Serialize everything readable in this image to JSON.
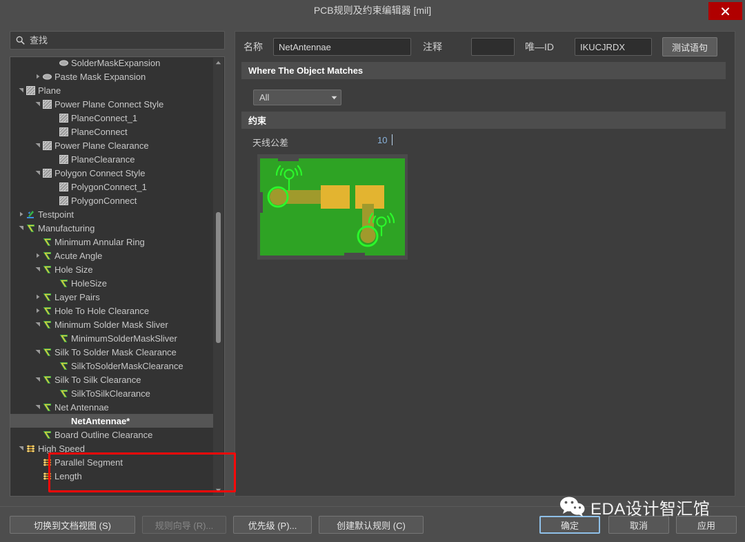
{
  "window": {
    "title": "PCB规则及约束编辑器 [mil]",
    "close_label": "✕",
    "close_color": "#b00000"
  },
  "search": {
    "placeholder": "查找",
    "value": "",
    "icon": "search-icon"
  },
  "tree": {
    "scroll_icons": {
      "up": "▲",
      "down": "▼"
    },
    "items": [
      {
        "label": "SolderMaskExpansion",
        "depth": 3,
        "twisty": "",
        "icon": "mask-icon",
        "selected": false
      },
      {
        "label": "Paste Mask Expansion",
        "depth": 2,
        "twisty": "▸",
        "icon": "mask-icon",
        "selected": false
      },
      {
        "label": "Plane",
        "depth": 1,
        "twisty": "▾",
        "icon": "plane-icon",
        "selected": false
      },
      {
        "label": "Power Plane Connect Style",
        "depth": 2,
        "twisty": "▾",
        "icon": "plane-icon",
        "selected": false
      },
      {
        "label": "PlaneConnect_1",
        "depth": 3,
        "twisty": "",
        "icon": "plane-icon",
        "selected": false
      },
      {
        "label": "PlaneConnect",
        "depth": 3,
        "twisty": "",
        "icon": "plane-icon",
        "selected": false
      },
      {
        "label": "Power Plane Clearance",
        "depth": 2,
        "twisty": "▾",
        "icon": "plane-icon",
        "selected": false
      },
      {
        "label": "PlaneClearance",
        "depth": 3,
        "twisty": "",
        "icon": "plane-icon",
        "selected": false
      },
      {
        "label": "Polygon Connect Style",
        "depth": 2,
        "twisty": "▾",
        "icon": "plane-icon",
        "selected": false
      },
      {
        "label": "PolygonConnect_1",
        "depth": 3,
        "twisty": "",
        "icon": "plane-icon",
        "selected": false
      },
      {
        "label": "PolygonConnect",
        "depth": 3,
        "twisty": "",
        "icon": "plane-icon",
        "selected": false
      },
      {
        "label": "Testpoint",
        "depth": 1,
        "twisty": "▸",
        "icon": "testpoint-icon",
        "selected": false
      },
      {
        "label": "Manufacturing",
        "depth": 1,
        "twisty": "▾",
        "icon": "mfg-icon",
        "selected": false
      },
      {
        "label": "Minimum Annular Ring",
        "depth": 2,
        "twisty": "",
        "icon": "mfg-icon",
        "selected": false
      },
      {
        "label": "Acute Angle",
        "depth": 2,
        "twisty": "▸",
        "icon": "mfg-icon",
        "selected": false
      },
      {
        "label": "Hole Size",
        "depth": 2,
        "twisty": "▾",
        "icon": "mfg-icon",
        "selected": false
      },
      {
        "label": "HoleSize",
        "depth": 3,
        "twisty": "",
        "icon": "mfg-icon",
        "selected": false
      },
      {
        "label": "Layer Pairs",
        "depth": 2,
        "twisty": "▸",
        "icon": "mfg-icon",
        "selected": false
      },
      {
        "label": "Hole To Hole Clearance",
        "depth": 2,
        "twisty": "▸",
        "icon": "mfg-icon",
        "selected": false
      },
      {
        "label": "Minimum Solder Mask Sliver",
        "depth": 2,
        "twisty": "▾",
        "icon": "mfg-icon",
        "selected": false
      },
      {
        "label": "MinimumSolderMaskSliver",
        "depth": 3,
        "twisty": "",
        "icon": "mfg-icon",
        "selected": false
      },
      {
        "label": "Silk To Solder Mask Clearance",
        "depth": 2,
        "twisty": "▾",
        "icon": "mfg-icon",
        "selected": false
      },
      {
        "label": "SilkToSolderMaskClearance",
        "depth": 3,
        "twisty": "",
        "icon": "mfg-icon",
        "selected": false
      },
      {
        "label": "Silk To Silk Clearance",
        "depth": 2,
        "twisty": "▾",
        "icon": "mfg-icon",
        "selected": false
      },
      {
        "label": "SilkToSilkClearance",
        "depth": 3,
        "twisty": "",
        "icon": "mfg-icon",
        "selected": false
      },
      {
        "label": "Net Antennae",
        "depth": 2,
        "twisty": "▾",
        "icon": "mfg-icon",
        "selected": false
      },
      {
        "label": "NetAntennae*",
        "depth": 3,
        "twisty": "",
        "icon": "mfg-icon",
        "selected": true
      },
      {
        "label": "Board Outline Clearance",
        "depth": 2,
        "twisty": "",
        "icon": "mfg-icon",
        "selected": false
      },
      {
        "label": "High Speed",
        "depth": 1,
        "twisty": "▾",
        "icon": "highspeed-icon",
        "selected": false
      },
      {
        "label": "Parallel Segment",
        "depth": 2,
        "twisty": "",
        "icon": "highspeed-icon",
        "selected": false
      },
      {
        "label": "Length",
        "depth": 2,
        "twisty": "",
        "icon": "highspeed-icon",
        "selected": false
      }
    ]
  },
  "editor": {
    "name_label": "名称",
    "name_value": "NetAntennae",
    "comment_label": "注释",
    "comment_value": "",
    "uniqueid_label": "唯—ID",
    "uniqueid_value": "IKUCJRDX",
    "test_button": "测试语句",
    "where_header": "Where The Object Matches",
    "scope_value": "All",
    "scope_arrow": "▼",
    "constraint_header": "约束",
    "constraint_label": "天线公差",
    "constraint_value": "10"
  },
  "pcb_preview": {
    "board_color": "#2ea324",
    "pad_color": "#e3b430",
    "trace_color": "#a09a2c",
    "highlight_color": "#2bf72b",
    "alt": "pcb-net-antennae-illustration"
  },
  "footer": {
    "switch_doc_view": "切换到文档视图 (S)",
    "rule_wizard": "规则向导 (R)...",
    "priority": "优先级 (P)...",
    "create_default": "创建默认规则 (C)",
    "ok": "确定",
    "cancel": "取消",
    "apply": "应用"
  },
  "watermark": {
    "text": "EDA设计智汇馆",
    "icon": "wechat-icon"
  }
}
